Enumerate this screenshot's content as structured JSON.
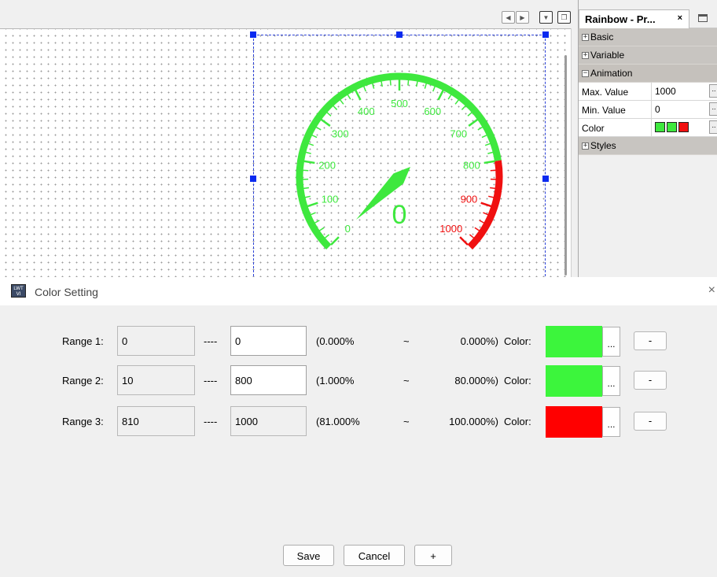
{
  "editor": {
    "nav_buttons": [
      "left-arrow-icon",
      "right-arrow-icon",
      "dropdown-icon",
      "restore-window-icon"
    ],
    "gauge": {
      "min": 0,
      "max": 1000,
      "value": 0,
      "value_label": "0",
      "ticks": [
        "0",
        "100",
        "200",
        "300",
        "400",
        "500",
        "600",
        "700",
        "800",
        "900",
        "1000"
      ],
      "ranges": [
        {
          "from": 0,
          "to": 800,
          "color": "#3ee83e"
        },
        {
          "from": 800,
          "to": 1000,
          "color": "#f01010"
        }
      ]
    }
  },
  "properties": {
    "tab_title": "Rainbow - Pr...",
    "tab_close": "×",
    "categories": {
      "basic": "Basic",
      "variable": "Variable",
      "animation": "Animation",
      "styles": "Styles"
    },
    "rows": [
      {
        "name": "Max. Value",
        "value": "1000"
      },
      {
        "name": "Min. Value",
        "value": "0"
      },
      {
        "name": "Color",
        "value": ""
      }
    ],
    "color_swatches": [
      "#3ee83e",
      "#3ee83e",
      "#f01010"
    ],
    "ellipsis": ".."
  },
  "dialog": {
    "title": "Color Setting",
    "icon_text": "LWT VI",
    "close": "×",
    "ranges": [
      {
        "label": "Range 1:",
        "from": "0",
        "to": "0",
        "pct_from": "(0.000%",
        "pct_to": "0.000%)",
        "color_label": "Color:",
        "color": "#3cf53c"
      },
      {
        "label": "Range 2:",
        "from": "10",
        "to": "800",
        "pct_from": "(1.000%",
        "pct_to": "80.000%)",
        "color_label": "Color:",
        "color": "#3cf53c"
      },
      {
        "label": "Range 3:",
        "from": "810",
        "to": "1000",
        "pct_from": "(81.000%",
        "pct_to": "100.000%)",
        "color_label": "Color:",
        "color": "#ff0000"
      }
    ],
    "dash": "----",
    "tilde": "~",
    "pick_label": "...",
    "minus_label": "-",
    "buttons": {
      "save": "Save",
      "cancel": "Cancel",
      "add": "+"
    }
  }
}
